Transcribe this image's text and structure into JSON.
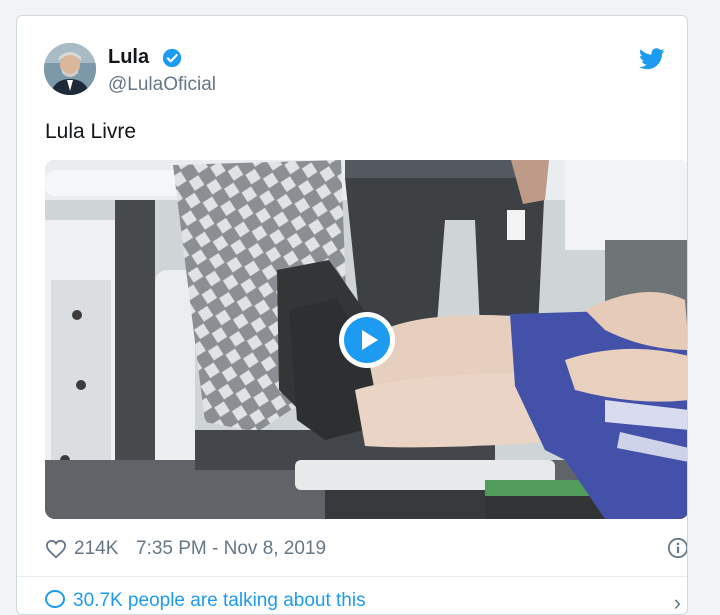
{
  "tweet": {
    "author_name": "Lula",
    "handle": "@LulaOficial",
    "text": "Lula Livre",
    "likes": "214K",
    "timestamp": "7:35 PM - Nov 8, 2019",
    "conversation_text": "30.7K people are talking about this"
  },
  "icons": {
    "verified": "verified-badge-icon",
    "brand": "twitter-bird-icon",
    "play": "play-icon",
    "like": "heart-icon",
    "info": "info-icon",
    "conversation": "comment-icon",
    "more": "chevron-right-icon"
  },
  "colors": {
    "accent": "#1d9bf0",
    "text": "#14171a",
    "muted": "#657786",
    "border": "#cfd9de"
  }
}
